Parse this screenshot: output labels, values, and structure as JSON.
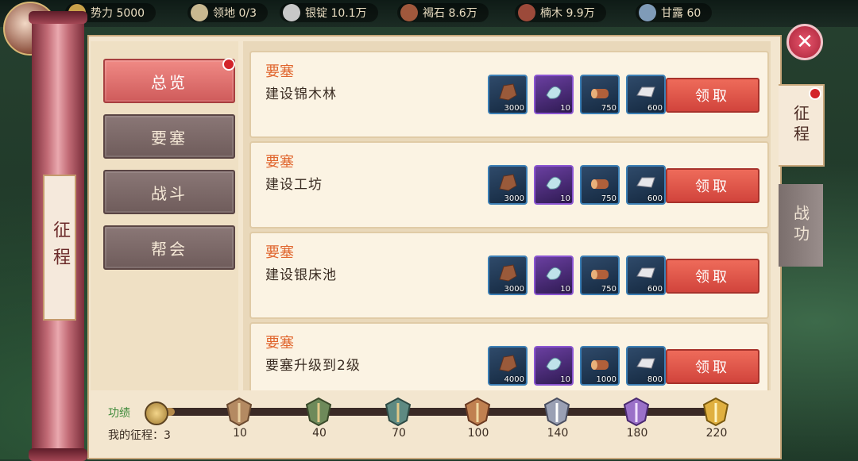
{
  "topbar": {
    "resources": [
      {
        "label": "势力 5000",
        "icon": "power-icon",
        "color": "#c9a24a"
      },
      {
        "label": "领地 0/3",
        "icon": "territory-icon",
        "color": "#c8b890"
      },
      {
        "label": "银锭 10.1万",
        "icon": "silver-icon",
        "color": "#c8c8c8"
      },
      {
        "label": "褐石 8.6万",
        "icon": "stone-icon",
        "color": "#a0583c"
      },
      {
        "label": "楠木 9.9万",
        "icon": "wood-icon",
        "color": "#9c4a3a"
      },
      {
        "label": "甘露 60",
        "icon": "dew-icon",
        "color": "#7f9bb8"
      }
    ]
  },
  "left_scroll_title": "征程",
  "menu": {
    "tabs": [
      {
        "label": "总览",
        "active": true,
        "badge": true
      },
      {
        "label": "要塞",
        "active": false,
        "badge": false
      },
      {
        "label": "战斗",
        "active": false,
        "badge": false
      },
      {
        "label": "帮会",
        "active": false,
        "badge": false
      }
    ]
  },
  "tasks": [
    {
      "category": "要塞",
      "description": "建设锦木林",
      "rewards": [
        "3000",
        "10",
        "750",
        "600"
      ],
      "button": "领取"
    },
    {
      "category": "要塞",
      "description": "建设工坊",
      "rewards": [
        "3000",
        "10",
        "750",
        "600"
      ],
      "button": "领取"
    },
    {
      "category": "要塞",
      "description": "建设银床池",
      "rewards": [
        "3000",
        "10",
        "750",
        "600"
      ],
      "button": "领取"
    },
    {
      "category": "要塞",
      "description": "要塞升级到2级",
      "rewards": [
        "4000",
        "10",
        "1000",
        "800"
      ],
      "button": "领取"
    }
  ],
  "right_tabs": [
    {
      "label": "征程",
      "active": true
    },
    {
      "label": "战功",
      "active": false
    }
  ],
  "progress": {
    "label": "功绩",
    "mine": "我的征程：3",
    "current": 3,
    "milestones": [
      "10",
      "40",
      "70",
      "100",
      "140",
      "180",
      "220"
    ]
  },
  "colors": {
    "accent": "#d1443c",
    "category": "#e0662e",
    "panel": "#f3e6cf"
  }
}
